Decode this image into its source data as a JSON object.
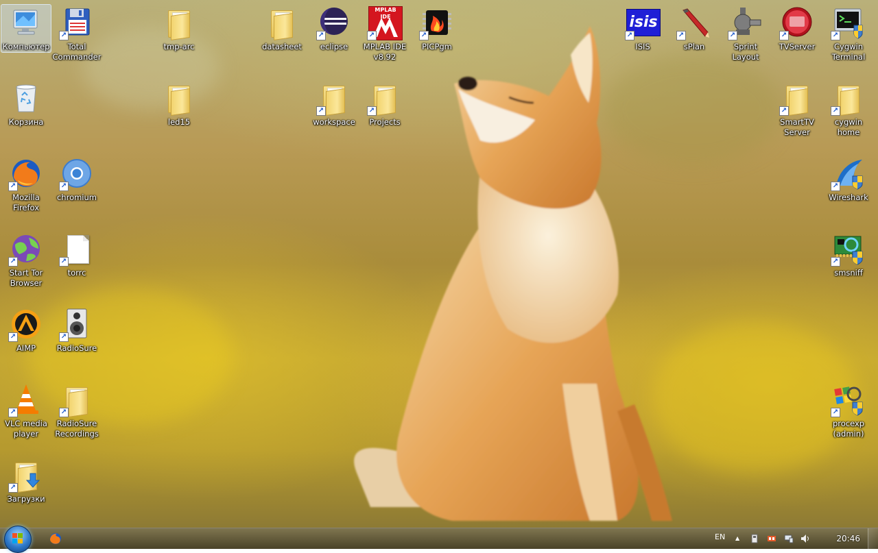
{
  "desktop": {
    "icons": [
      {
        "label": "Компьютер"
      },
      {
        "label": "Total Commander"
      },
      {
        "label": "tmp-arc"
      },
      {
        "label": "datasheet"
      },
      {
        "label": "eclipse"
      },
      {
        "label": "MPLAB IDE v8.92"
      },
      {
        "label": "PICPgm"
      },
      {
        "label": "ISIS"
      },
      {
        "label": "sPlan"
      },
      {
        "label": "Sprint Layout"
      },
      {
        "label": "TVServer"
      },
      {
        "label": "Cygwin Terminal"
      },
      {
        "label": "Корзина"
      },
      {
        "label": "led15"
      },
      {
        "label": "workspace"
      },
      {
        "label": "Projects"
      },
      {
        "label": "SmartTV Server"
      },
      {
        "label": "cygwin home"
      },
      {
        "label": "Mozilla Firefox"
      },
      {
        "label": "chromium"
      },
      {
        "label": "Wireshark"
      },
      {
        "label": "Start Tor Browser"
      },
      {
        "label": "torrc"
      },
      {
        "label": "smsniff"
      },
      {
        "label": "AIMP"
      },
      {
        "label": "RadioSure"
      },
      {
        "label": "VLC media player"
      },
      {
        "label": "RadioSure Recordings"
      },
      {
        "label": "procexp (admin)"
      },
      {
        "label": "Загрузки"
      }
    ],
    "mplab_badge_text": "MPLAB IDE",
    "isis_badge_text": "isis"
  },
  "taskbar": {
    "language": "EN",
    "clock": "20:46",
    "tray_arrow": "▲"
  },
  "colors": {
    "selection": "#cde1fa",
    "taskbar": "#5a5230",
    "start_orb": "#2d78c8"
  }
}
